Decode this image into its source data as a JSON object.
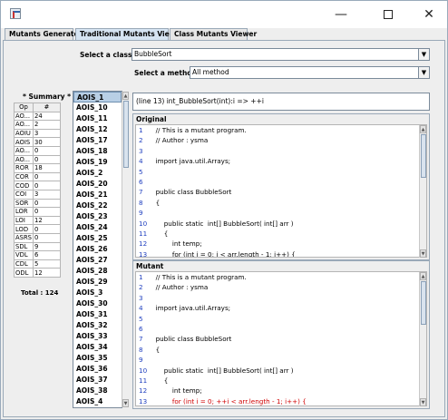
{
  "tabs": [
    {
      "label": "Mutants Generator",
      "active": false
    },
    {
      "label": "Traditional Mutants Viewer",
      "active": true
    },
    {
      "label": "Class Mutants Viewer",
      "active": false
    }
  ],
  "class_selector": {
    "label": "Select a class :",
    "value": "BubbleSort"
  },
  "method_selector": {
    "label": "Select a method :",
    "value": "All method"
  },
  "summary": {
    "title": "* Summary *",
    "headers": [
      "Op",
      "#"
    ],
    "rows": [
      [
        "AO...",
        "24"
      ],
      [
        "AO...",
        "2"
      ],
      [
        "AOIU",
        "3"
      ],
      [
        "AOIS",
        "30"
      ],
      [
        "AO...",
        "0"
      ],
      [
        "AO...",
        "0"
      ],
      [
        "ROR",
        "18"
      ],
      [
        "COR",
        "0"
      ],
      [
        "COD",
        "0"
      ],
      [
        "COI",
        "3"
      ],
      [
        "SOR",
        "0"
      ],
      [
        "LOR",
        "0"
      ],
      [
        "LOI",
        "12"
      ],
      [
        "LOD",
        "0"
      ],
      [
        "ASRS",
        "0"
      ],
      [
        "SDL",
        "9"
      ],
      [
        "VDL",
        "6"
      ],
      [
        "CDL",
        "5"
      ],
      [
        "ODL",
        "12"
      ]
    ],
    "total": "Total : 124"
  },
  "mutant_list": {
    "selected_index": 0,
    "items": [
      "AOIS_1",
      "AOIS_10",
      "AOIS_11",
      "AOIS_12",
      "AOIS_17",
      "AOIS_18",
      "AOIS_19",
      "AOIS_2",
      "AOIS_20",
      "AOIS_21",
      "AOIS_22",
      "AOIS_23",
      "AOIS_24",
      "AOIS_25",
      "AOIS_26",
      "AOIS_27",
      "AOIS_28",
      "AOIS_29",
      "AOIS_3",
      "AOIS_30",
      "AOIS_31",
      "AOIS_32",
      "AOIS_33",
      "AOIS_34",
      "AOIS_35",
      "AOIS_36",
      "AOIS_37",
      "AOIS_38",
      "AOIS_4"
    ]
  },
  "mutation_description": "(line 13) int_BubbleSort(int):i => ++i",
  "original": {
    "title": "Original",
    "lines": [
      {
        "n": "1",
        "text": "  // This is a mutant program."
      },
      {
        "n": "2",
        "text": "  // Author : ysma"
      },
      {
        "n": "3",
        "text": ""
      },
      {
        "n": "4",
        "text": "  import java.util.Arrays;"
      },
      {
        "n": "5",
        "text": ""
      },
      {
        "n": "6",
        "text": ""
      },
      {
        "n": "7",
        "text": "  public class BubbleSort"
      },
      {
        "n": "8",
        "text": "  {"
      },
      {
        "n": "9",
        "text": ""
      },
      {
        "n": "10",
        "text": "      public static  int[] BubbleSort( int[] arr )"
      },
      {
        "n": "11",
        "text": "      {"
      },
      {
        "n": "12",
        "text": "          int temp;"
      },
      {
        "n": "13",
        "text": "          for (int i = 0; i < arr.length - 1; i++) {"
      }
    ]
  },
  "mutant": {
    "title": "Mutant",
    "mutated_line": "13",
    "lines": [
      {
        "n": "1",
        "text": "  // This is a mutant program."
      },
      {
        "n": "2",
        "text": "  // Author : ysma"
      },
      {
        "n": "3",
        "text": ""
      },
      {
        "n": "4",
        "text": "  import java.util.Arrays;"
      },
      {
        "n": "5",
        "text": ""
      },
      {
        "n": "6",
        "text": ""
      },
      {
        "n": "7",
        "text": "  public class BubbleSort"
      },
      {
        "n": "8",
        "text": "  {"
      },
      {
        "n": "9",
        "text": ""
      },
      {
        "n": "10",
        "text": "      public static  int[] BubbleSort( int[] arr )"
      },
      {
        "n": "11",
        "text": "      {"
      },
      {
        "n": "12",
        "text": "          int temp;"
      },
      {
        "n": "13",
        "text": "          for (int i = 0; ++i < arr.length - 1; i++) {"
      }
    ]
  },
  "colors": {
    "line_number": "#1f3fbf",
    "mutated_text": "#d00000",
    "selection": "#b8cfe5"
  },
  "icons": {
    "app": "app-icon",
    "minimize": "minimize-icon",
    "maximize": "maximize-icon",
    "close": "close-icon",
    "dropdown": "chevron-down-icon"
  }
}
